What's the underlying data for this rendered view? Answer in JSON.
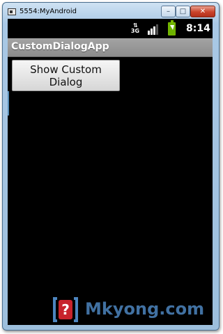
{
  "window": {
    "title": "5554:MyAndroid",
    "minimize_glyph": "–",
    "maximize_glyph": "□",
    "close_glyph": "✕"
  },
  "status_bar": {
    "network_type": "3G",
    "network_arrows": "⇅",
    "time": "8:14",
    "icons": [
      "3g-data-icon",
      "signal-bars-icon",
      "battery-charging-icon"
    ]
  },
  "app": {
    "title": "CustomDialogApp",
    "button_label": "Show Custom Dialog"
  },
  "watermark": {
    "text": "Mkyong.com",
    "logo_glyph": "?"
  },
  "colors": {
    "screen_bg": "#000000",
    "title_bar": "#999999",
    "button_bg": "#e4e4e4",
    "battery": "#6db300",
    "watermark": "#4d85bf",
    "logo_red": "#c8232c"
  }
}
